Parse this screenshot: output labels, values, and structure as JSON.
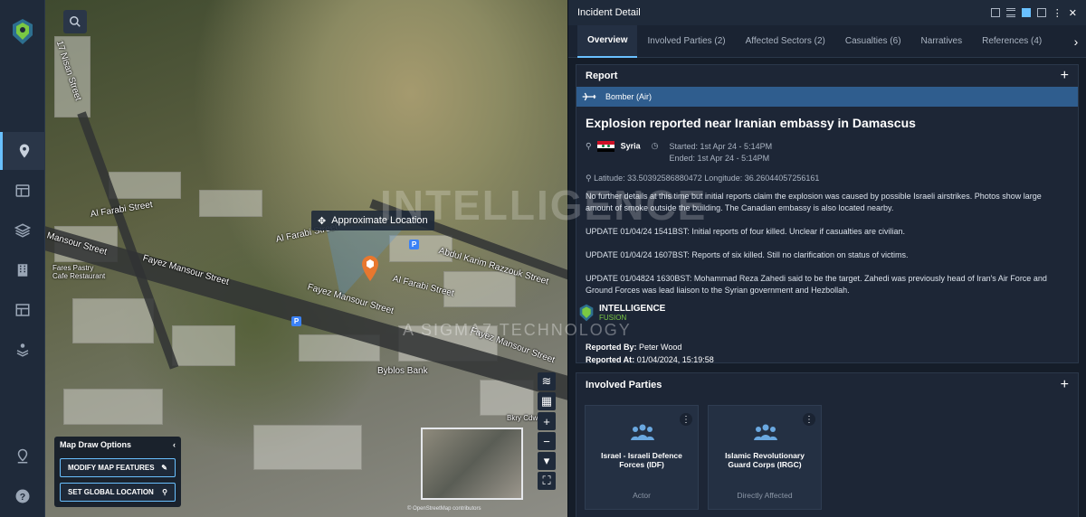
{
  "nav": {
    "items": [
      "location",
      "dashboard",
      "layers",
      "buildings",
      "table",
      "stack"
    ],
    "bottom": [
      "location-pin",
      "help"
    ]
  },
  "map": {
    "approx_label": "Approximate Location",
    "streets": [
      {
        "text": "Al Farabi Street"
      },
      {
        "text": "Mansour Street"
      },
      {
        "text": "Fayez Mansour Street"
      },
      {
        "text": "Fayez Mansour Street"
      },
      {
        "text": "Al Farabi Street"
      },
      {
        "text": "Al Farabi Street"
      },
      {
        "text": "Abdul Karim Razzouk Street"
      },
      {
        "text": "Fayez Mansour Street"
      },
      {
        "text": "Byblos Bank"
      },
      {
        "text": "Fares Pastry Cafe Restaurant"
      },
      {
        "text": "17 Nisan Street"
      },
      {
        "text": "Bkry Cdwr"
      }
    ],
    "draw_options": {
      "title": "Map Draw Options",
      "modify_label": "MODIFY MAP FEATURES",
      "set_location_label": "SET GLOBAL LOCATION"
    },
    "attribution": "© OpenStreetMap contributors"
  },
  "panel": {
    "title": "Incident Detail",
    "tabs": [
      {
        "label": "Overview",
        "active": true
      },
      {
        "label": "Involved Parties (2)"
      },
      {
        "label": "Affected Sectors (2)"
      },
      {
        "label": "Casualties (6)"
      },
      {
        "label": "Narratives"
      },
      {
        "label": "References (4)"
      }
    ],
    "report": {
      "section_title": "Report",
      "category": "Bomber (Air)",
      "headline": "Explosion reported near Iranian embassy in Damascus",
      "country": "Syria",
      "started": "Started: 1st Apr 24 - 5:14PM",
      "ended": "Ended: 1st Apr 24 - 5:14PM",
      "coords": "Latitude: 33.50392586880472 Longitude: 36.26044057256161",
      "paragraphs": [
        "No further details at this time but initial reports claim the explosion was caused by possible Israeli airstrikes. Photos show large amount of smoke outside the building. The Canadian embassy is also located nearby.",
        "UPDATE 01/04/24 1541BST: Initial reports of four killed. Unclear if casualties are civilian.",
        "UPDATE 01/04/24 1607BST: Reports of six killed. Still no clarification on status of victims.",
        "UPDATE 01/04824 1630BST: Mohammad Reza Zahedi said to be the target. Zahedi was previously head of Iran's Air Force and Ground Forces was lead liaison to the Syrian government and Hezbollah."
      ],
      "reported_by_label": "Reported By:",
      "reported_by": "Peter Wood",
      "reported_at_label": "Reported At:",
      "reported_at": "01/04/2024, 15:19:58"
    },
    "parties": {
      "section_title": "Involved Parties",
      "items": [
        {
          "name": "Israel - Israeli Defence Forces (IDF)",
          "role": "Actor"
        },
        {
          "name": "Islamic Revolutionary Guard Corps (IRGC)",
          "role": "Directly Affected"
        }
      ]
    }
  },
  "watermark": {
    "big": "INTELLIGENCE",
    "logo_line1": "INTELLIGENCE",
    "logo_line2": "FUSION",
    "sub": "A SIGMA7 TECHNOLOGY"
  },
  "colors": {
    "accent": "#69c0ff",
    "category_bar": "#2f5d8e",
    "pin": "#e8772e",
    "logo_green": "#7ac943"
  }
}
